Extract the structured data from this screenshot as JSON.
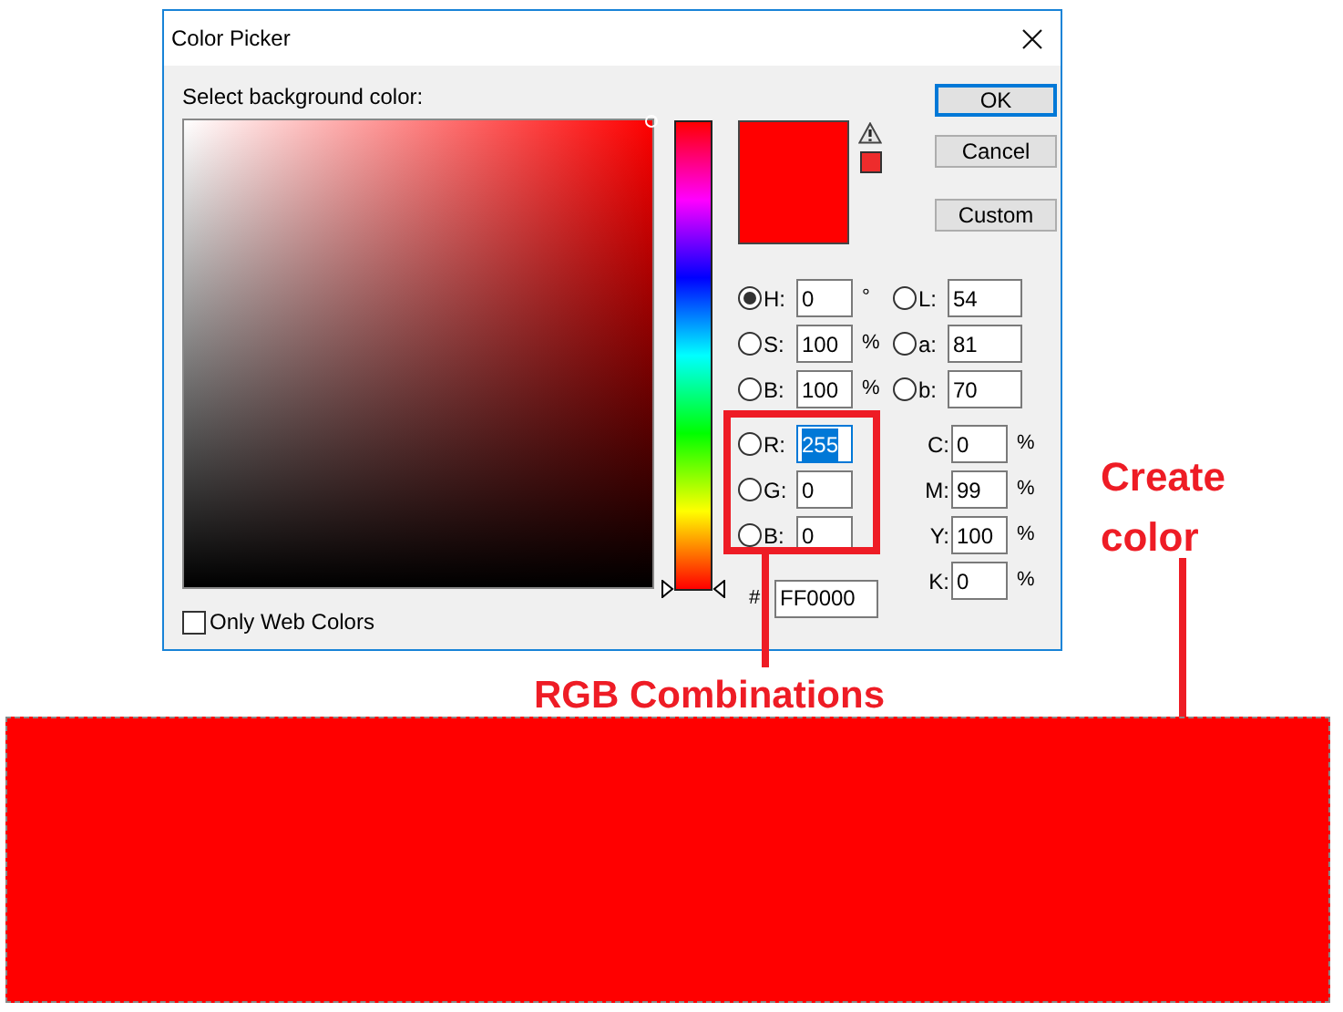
{
  "window": {
    "title": "Color Picker"
  },
  "prompt": "Select background color:",
  "hue_slider": {
    "level": 0
  },
  "buttons": [
    {
      "label": "OK",
      "default": true
    },
    {
      "label": "Cancel",
      "default": false
    },
    {
      "label": "Custom",
      "default": false
    }
  ],
  "hsb": [
    {
      "label": "H:",
      "value": "0",
      "unit": "°",
      "selected": true
    },
    {
      "label": "S:",
      "value": "100",
      "unit": "%",
      "selected": false
    },
    {
      "label": "B:",
      "value": "100",
      "unit": "%",
      "selected": false
    }
  ],
  "rgb": [
    {
      "label": "R:",
      "value": "255",
      "selected": false,
      "text_selected": true
    },
    {
      "label": "G:",
      "value": "0",
      "selected": false,
      "text_selected": false
    },
    {
      "label": "B:",
      "value": "0",
      "selected": false,
      "text_selected": false
    }
  ],
  "hex": {
    "label": "#",
    "value": "FF0000"
  },
  "lab": [
    {
      "label": "L:",
      "value": "54",
      "selected": false
    },
    {
      "label": "a:",
      "value": "81",
      "selected": false
    },
    {
      "label": "b:",
      "value": "70",
      "selected": false
    }
  ],
  "cmyk": [
    {
      "label": "C:",
      "value": "0",
      "unit": "%"
    },
    {
      "label": "M:",
      "value": "99",
      "unit": "%"
    },
    {
      "label": "Y:",
      "value": "100",
      "unit": "%"
    },
    {
      "label": "K:",
      "value": "0",
      "unit": "%"
    }
  ],
  "web_colors": {
    "label": "Only Web Colors",
    "checked": false
  },
  "annotations": [
    {
      "text": "RGB Combinations"
    },
    {
      "text": "Create color"
    }
  ]
}
